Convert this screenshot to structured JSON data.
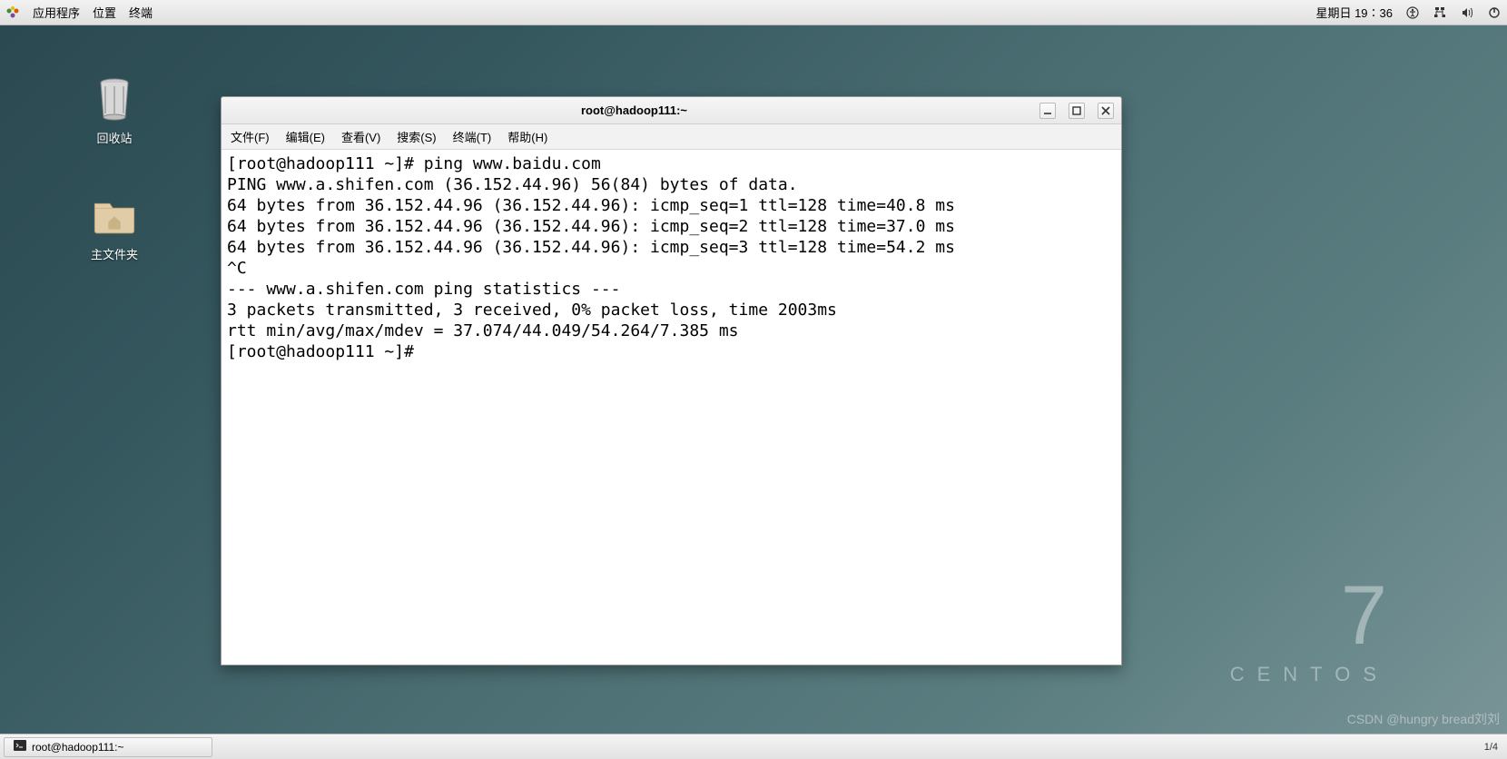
{
  "panel": {
    "apps": "应用程序",
    "places": "位置",
    "terminal": "终端",
    "datetime": "星期日 19∶36"
  },
  "desktop": {
    "trash": "回收站",
    "home": "主文件夹"
  },
  "window": {
    "title": "root@hadoop111:~",
    "menu": {
      "file": "文件(F)",
      "edit": "编辑(E)",
      "view": "查看(V)",
      "search": "搜索(S)",
      "terminal": "终端(T)",
      "help": "帮助(H)"
    },
    "content": "[root@hadoop111 ~]# ping www.baidu.com\nPING www.a.shifen.com (36.152.44.96) 56(84) bytes of data.\n64 bytes from 36.152.44.96 (36.152.44.96): icmp_seq=1 ttl=128 time=40.8 ms\n64 bytes from 36.152.44.96 (36.152.44.96): icmp_seq=2 ttl=128 time=37.0 ms\n64 bytes from 36.152.44.96 (36.152.44.96): icmp_seq=3 ttl=128 time=54.2 ms\n^C\n--- www.a.shifen.com ping statistics ---\n3 packets transmitted, 3 received, 0% packet loss, time 2003ms\nrtt min/avg/max/mdev = 37.074/44.049/54.264/7.385 ms\n[root@hadoop111 ~]# "
  },
  "brand": {
    "num": "7",
    "name": "CENTOS"
  },
  "taskbar": {
    "item": "root@hadoop111:~",
    "page": "1/4"
  },
  "watermark": "CSDN @hungry bread刘刘"
}
